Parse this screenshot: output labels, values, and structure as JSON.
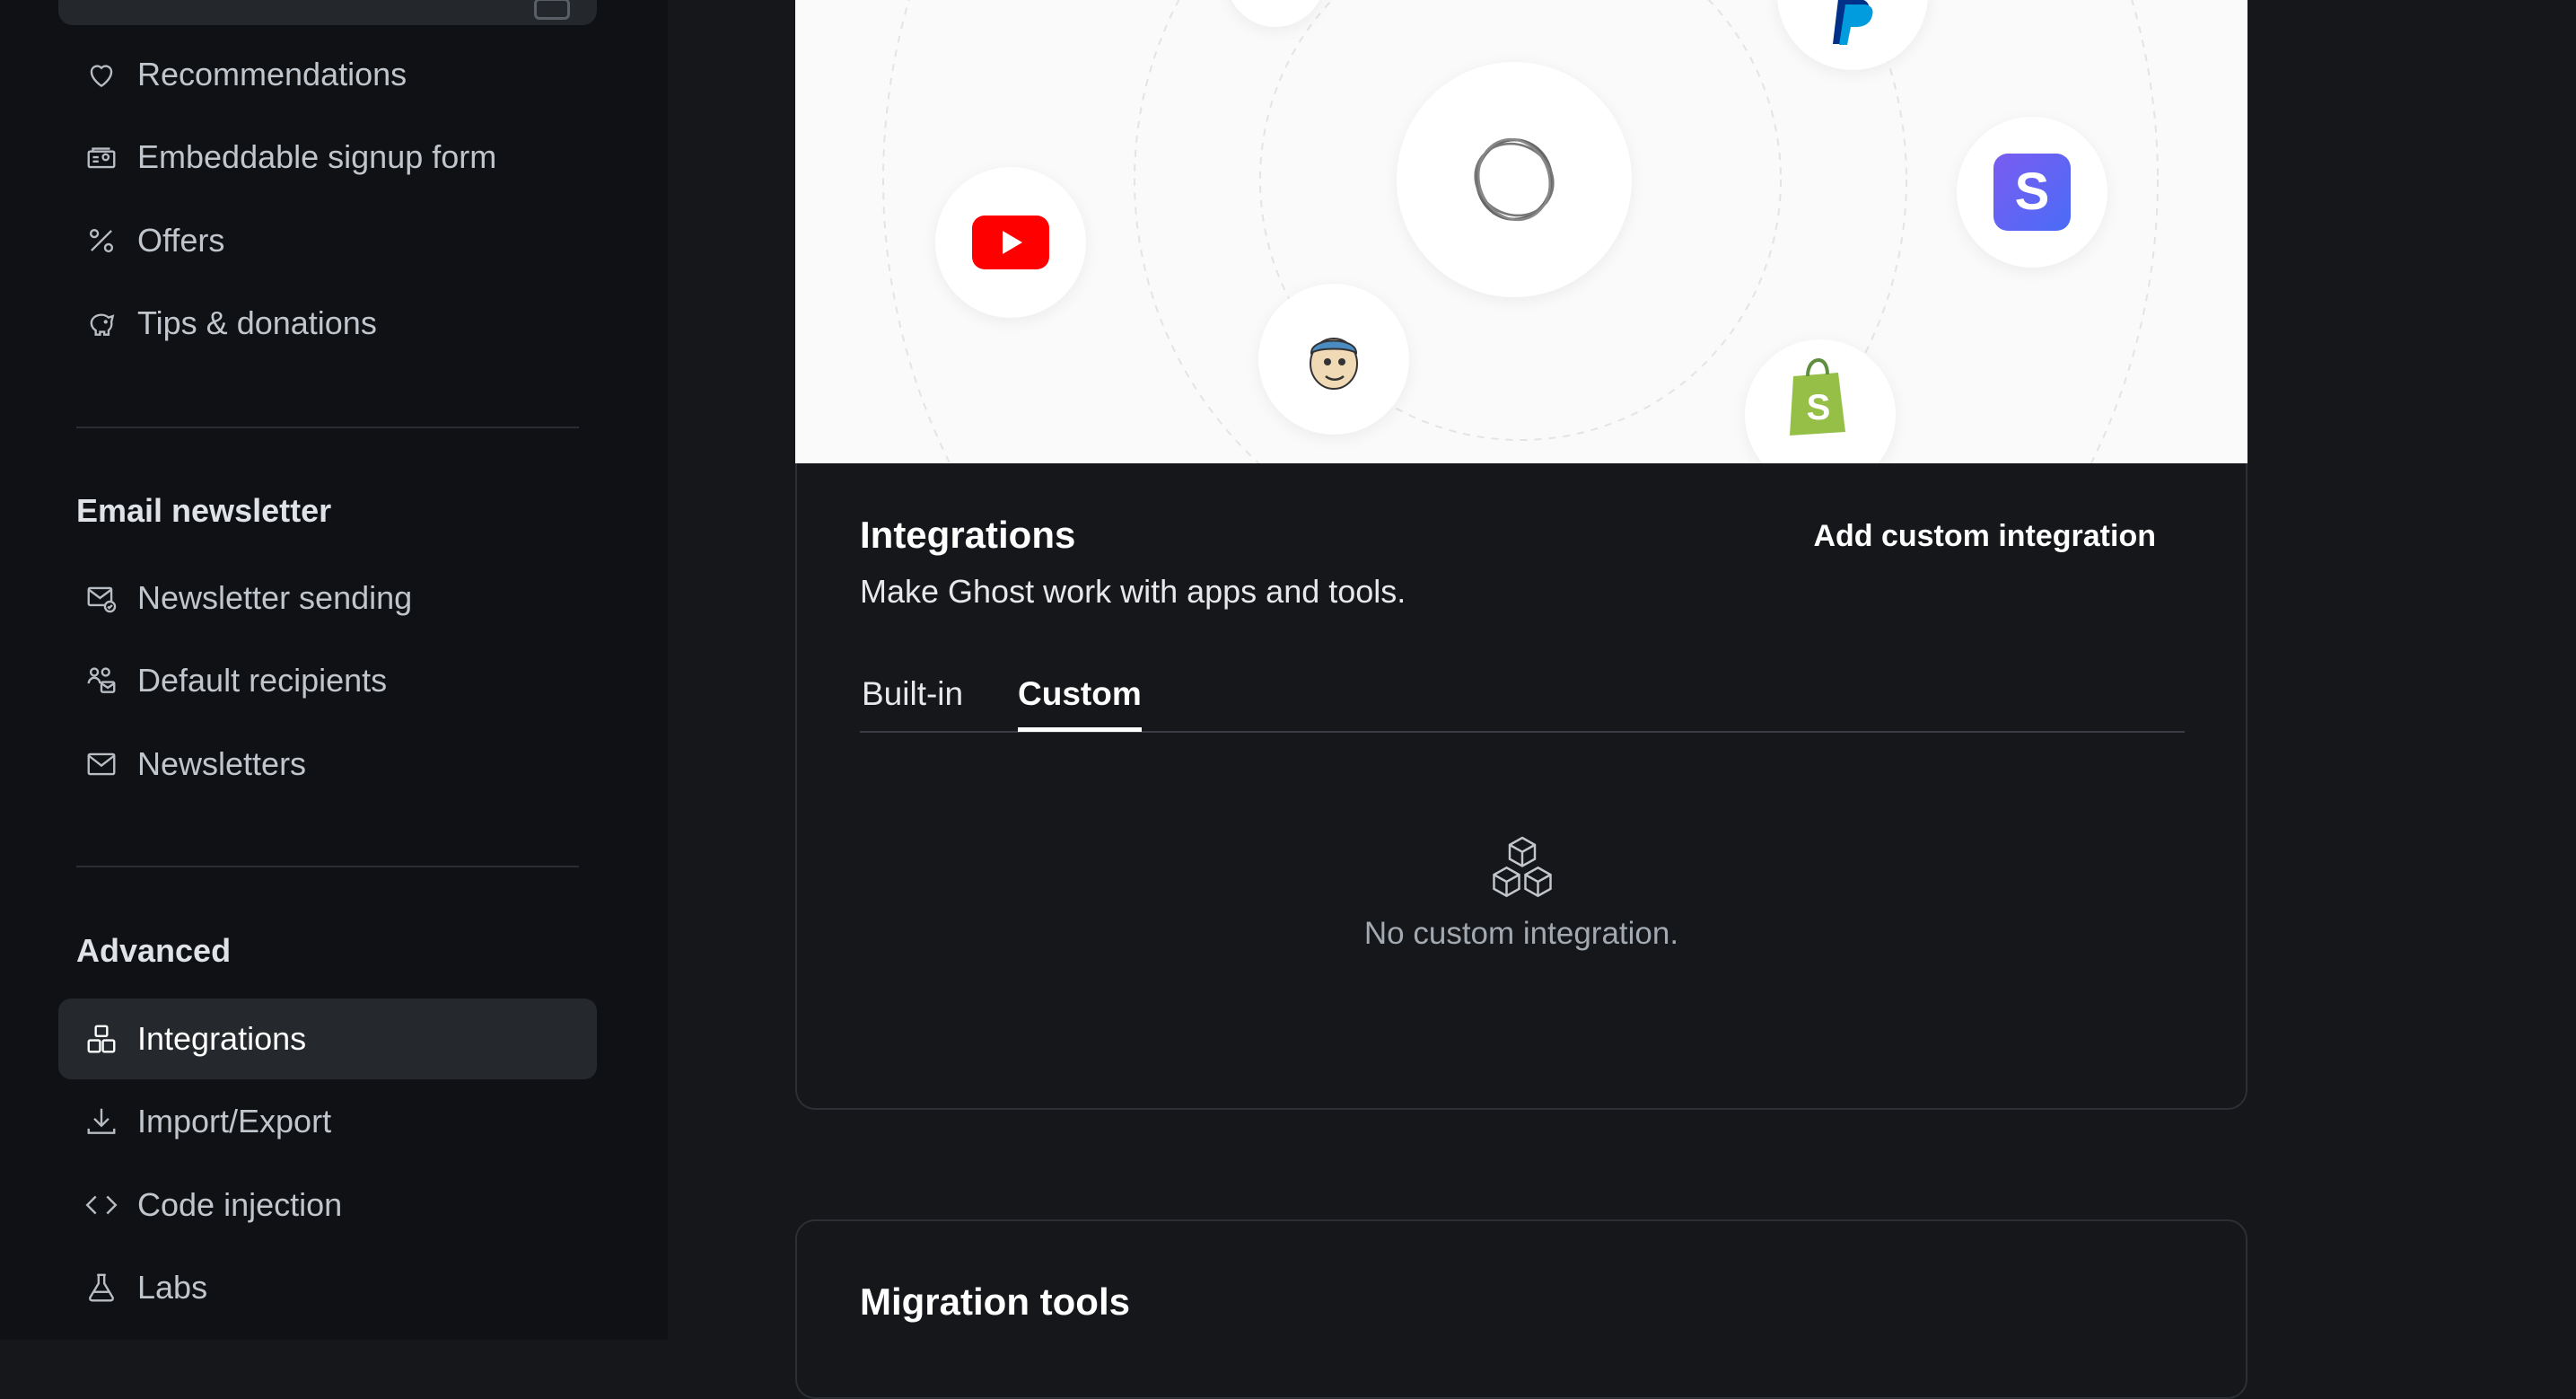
{
  "sidebar": {
    "top_items": [
      {
        "label": "Recommendations",
        "icon": "heart-icon"
      },
      {
        "label": "Embeddable signup form",
        "icon": "signup-form-icon"
      },
      {
        "label": "Offers",
        "icon": "percent-icon"
      },
      {
        "label": "Tips & donations",
        "icon": "piggy-bank-icon"
      }
    ],
    "email_section": {
      "title": "Email newsletter",
      "items": [
        {
          "label": "Newsletter sending",
          "icon": "mail-check-icon"
        },
        {
          "label": "Default recipients",
          "icon": "users-mail-icon"
        },
        {
          "label": "Newsletters",
          "icon": "envelope-icon"
        }
      ]
    },
    "advanced_section": {
      "title": "Advanced",
      "items": [
        {
          "label": "Integrations",
          "icon": "integrations-icon",
          "active": true
        },
        {
          "label": "Import/Export",
          "icon": "download-icon"
        },
        {
          "label": "Code injection",
          "icon": "code-icon"
        },
        {
          "label": "Labs",
          "icon": "flask-icon"
        }
      ]
    }
  },
  "integrations": {
    "title": "Integrations",
    "description": "Make Ghost work with apps and tools.",
    "add_button": "Add custom integration",
    "tabs": [
      {
        "label": "Built-in",
        "active": false
      },
      {
        "label": "Custom",
        "active": true
      }
    ],
    "empty_state": {
      "icon": "cubes-icon",
      "text": "No custom integration."
    },
    "hero_logos": [
      "youtube-logo",
      "mailchimp-logo",
      "ghost-logo",
      "paypal-logo",
      "stripe-logo",
      "shopify-logo"
    ]
  },
  "migration": {
    "title": "Migration tools"
  },
  "colors": {
    "background": "#15171a",
    "sidebar": "#101114",
    "active_item": "#25282d",
    "hero_bg": "#fafafa",
    "youtube": "#ff0000",
    "stripe": "#635bff",
    "shopify": "#95bf47",
    "paypal": "#003087"
  }
}
